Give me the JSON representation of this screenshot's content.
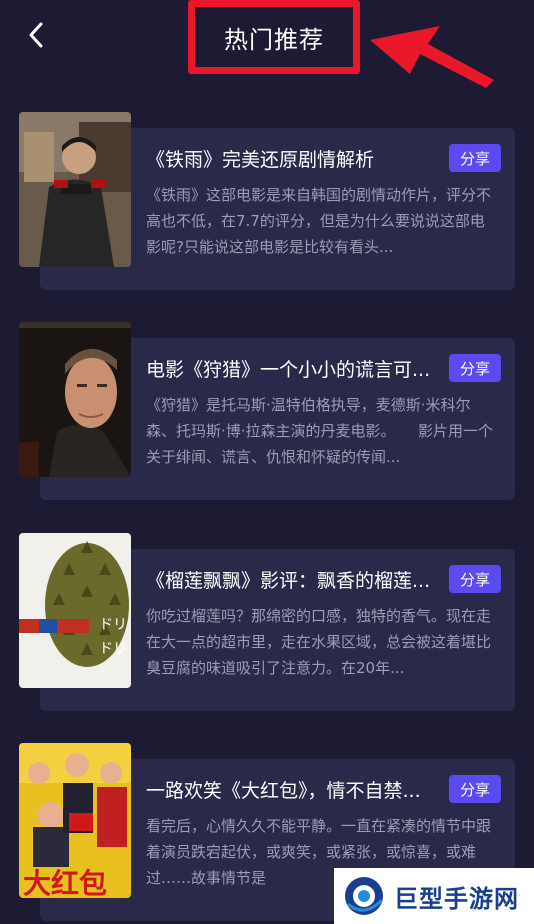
{
  "header": {
    "back_icon": "chevron-left-icon",
    "title": "热门推荐"
  },
  "colors": {
    "background": "#1c1b33",
    "card": "#29294a",
    "share_button": "#5a4bf0",
    "annotation_red": "#e8182a",
    "description_text": "#9c9cb4"
  },
  "articles": [
    {
      "title": "《铁雨》完美还原剧情解析",
      "description": "《铁雨》这部电影是来自韩国的剧情动作片，评分不高也不低，在7.7的评分，但是为什么要说说这部电影呢?只能说这部电影是比较有看头...",
      "share_label": "分享"
    },
    {
      "title": "电影《狩猎》一个小小的谎言可...",
      "description": "《狩猎》是托马斯·温特伯格执导，麦德斯·米科尔森、托玛斯·博·拉森主演的丹麦电影。　　影片用一个关于绯闻、谎言、仇恨和怀疑的传闻...",
      "share_label": "分享"
    },
    {
      "title": "《榴莲飘飘》影评：飘香的榴莲...",
      "description": "你吃过榴莲吗？那绵密的口感，独特的香气。现在走在大一点的超市里，走在水果区域，总会被这着堪比臭豆腐的味道吸引了注意力。在20年...",
      "share_label": "分享"
    },
    {
      "title": "一路欢笑《大红包》，情不自禁...",
      "description": "看完后，心情久久不能平静。一直在紧凑的情节中跟着演员跌宕起伏，或爽笑，或紧张，或惊喜，或难过……故事情节是",
      "share_label": "分享"
    }
  ],
  "watermark": {
    "text": "巨型手游网"
  }
}
